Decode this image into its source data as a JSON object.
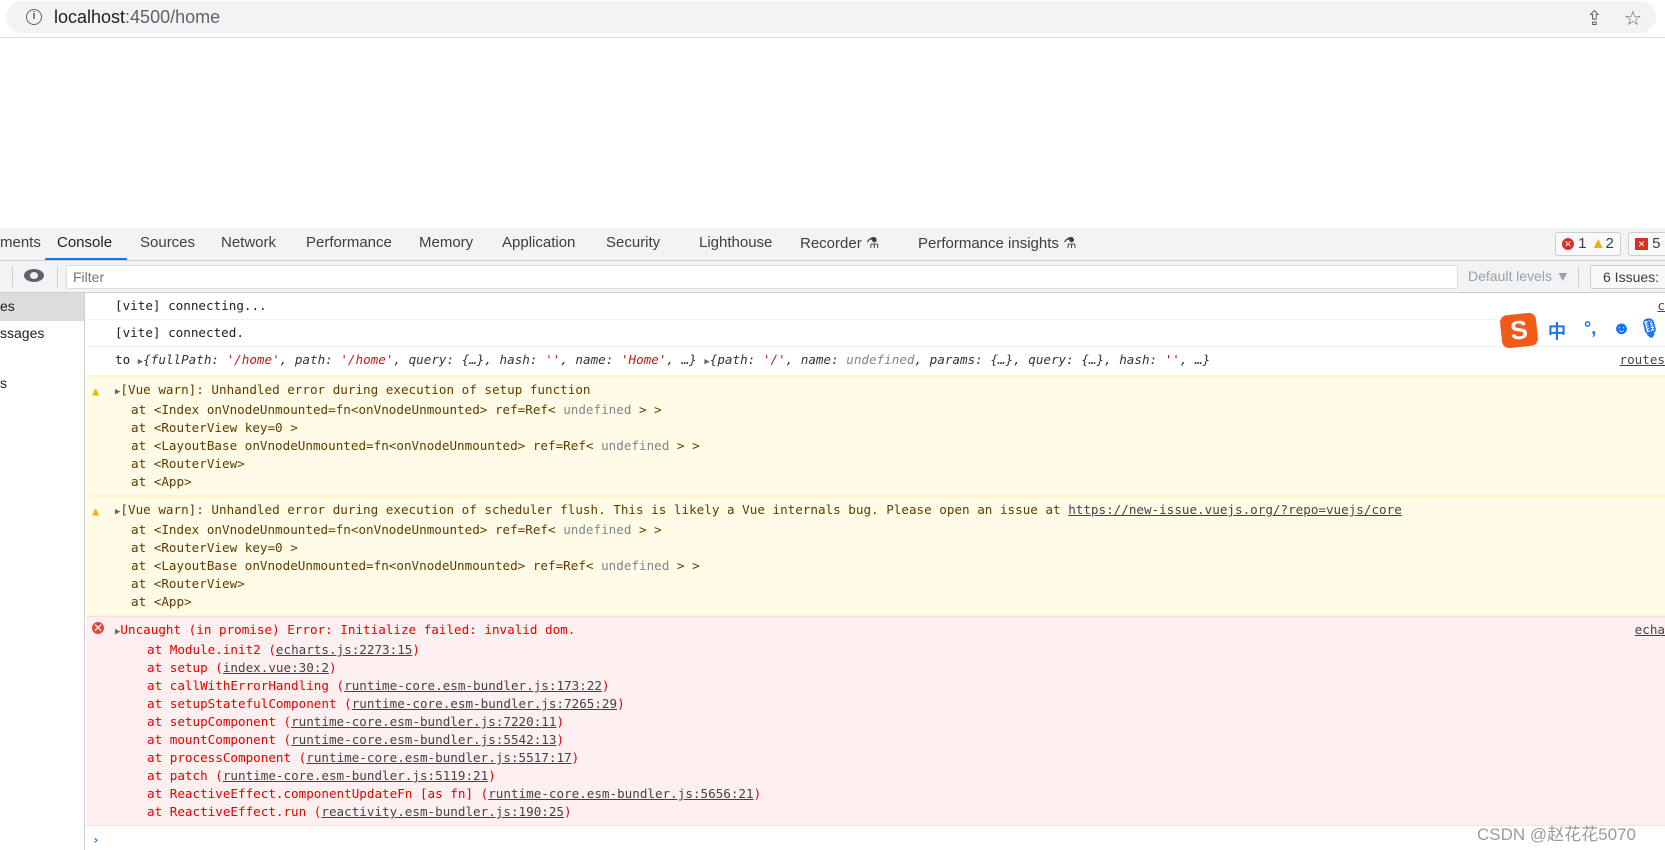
{
  "browser": {
    "url_host": "localhost",
    "url_rest": ":4500/home",
    "share_icon": "share-icon",
    "star_icon": "star-icon"
  },
  "devtools": {
    "tabs": [
      "ments",
      "Console",
      "Sources",
      "Network",
      "Performance",
      "Memory",
      "Application",
      "Security",
      "Lighthouse",
      "Recorder ⚗",
      "Performance insights ⚗"
    ],
    "active_tab": "Console",
    "counts": {
      "errors": "1",
      "warnings": "2",
      "issues": "5"
    },
    "toolbar": {
      "filter_placeholder": "Filter",
      "levels": "Default levels ▼",
      "issues": "6 Issues:"
    },
    "sidebar": [
      "es",
      "ssages",
      "",
      "s"
    ],
    "rows": [
      {
        "type": "log",
        "segs": [
          {
            "t": "[vite] connecting..."
          }
        ],
        "src": "c"
      },
      {
        "type": "log",
        "segs": [
          {
            "t": "[vite] connected."
          }
        ],
        "src": ""
      },
      {
        "type": "log",
        "segs": [
          {
            "t": "to "
          },
          {
            "t": "▶",
            "c": "exp"
          },
          {
            "t": "{fullPath: ",
            "c": "it"
          },
          {
            "t": "'/home'",
            "c": "str it"
          },
          {
            "t": ", path: ",
            "c": "it"
          },
          {
            "t": "'/home'",
            "c": "str it"
          },
          {
            "t": ", query: {…}, hash: ",
            "c": "it"
          },
          {
            "t": "''",
            "c": "str it"
          },
          {
            "t": ", name: ",
            "c": "it"
          },
          {
            "t": "'Home'",
            "c": "str it"
          },
          {
            "t": ", …} ",
            "c": "it"
          },
          {
            "t": "▶",
            "c": "exp"
          },
          {
            "t": "{path: ",
            "c": "it"
          },
          {
            "t": "'/'",
            "c": "str it"
          },
          {
            "t": ", name: ",
            "c": "it"
          },
          {
            "t": "undefined",
            "c": "gray it"
          },
          {
            "t": ", params: {…}, query: {…}, hash: ",
            "c": "it"
          },
          {
            "t": "''",
            "c": "str it"
          },
          {
            "t": ", …}",
            "c": "it"
          }
        ],
        "src": "routes"
      },
      {
        "type": "warn",
        "head": "[Vue warn]: Unhandled error during execution of setup function",
        "link": "",
        "sub": [
          [
            {
              "t": "at <Index onVnodeUnmounted=fn<onVnodeUnmounted> ref=Ref< "
            },
            {
              "t": "undefined",
              "c": "gray"
            },
            {
              "t": " > >"
            }
          ],
          [
            {
              "t": "at <RouterView key=0 >"
            }
          ],
          [
            {
              "t": "at <LayoutBase onVnodeUnmounted=fn<onVnodeUnmounted> ref=Ref< "
            },
            {
              "t": "undefined",
              "c": "gray"
            },
            {
              "t": " > >"
            }
          ],
          [
            {
              "t": "at <RouterView>"
            }
          ],
          [
            {
              "t": "at <App>"
            }
          ]
        ]
      },
      {
        "type": "warn",
        "head": "[Vue warn]: Unhandled error during execution of scheduler flush. This is likely a Vue internals bug. Please open an issue at ",
        "link": "https://new-issue.vuejs.org/?repo=vuejs/core",
        "sub": [
          [
            {
              "t": "at <Index onVnodeUnmounted=fn<onVnodeUnmounted> ref=Ref< "
            },
            {
              "t": "undefined",
              "c": "gray"
            },
            {
              "t": " > >"
            }
          ],
          [
            {
              "t": "at <RouterView key=0 >"
            }
          ],
          [
            {
              "t": "at <LayoutBase onVnodeUnmounted=fn<onVnodeUnmounted> ref=Ref< "
            },
            {
              "t": "undefined",
              "c": "gray"
            },
            {
              "t": " > >"
            }
          ],
          [
            {
              "t": "at <RouterView>"
            }
          ],
          [
            {
              "t": "at <App>"
            }
          ]
        ]
      },
      {
        "type": "err",
        "head": "Uncaught (in promise) Error: Initialize failed: invalid dom.",
        "src": "echa",
        "stack": [
          {
            "fn": "at Module.init2 (",
            "file": "echarts.js:2273:15"
          },
          {
            "fn": "at setup (",
            "file": "index.vue:30:2"
          },
          {
            "fn": "at callWithErrorHandling (",
            "file": "runtime-core.esm-bundler.js:173:22"
          },
          {
            "fn": "at setupStatefulComponent (",
            "file": "runtime-core.esm-bundler.js:7265:29"
          },
          {
            "fn": "at setupComponent (",
            "file": "runtime-core.esm-bundler.js:7220:11"
          },
          {
            "fn": "at mountComponent (",
            "file": "runtime-core.esm-bundler.js:5542:13"
          },
          {
            "fn": "at processComponent (",
            "file": "runtime-core.esm-bundler.js:5517:17"
          },
          {
            "fn": "at patch (",
            "file": "runtime-core.esm-bundler.js:5119:21"
          },
          {
            "fn": "at ReactiveEffect.componentUpdateFn [as fn] (",
            "file": "runtime-core.esm-bundler.js:5656:21"
          },
          {
            "fn": "at ReactiveEffect.run (",
            "file": "reactivity.esm-bundler.js:190:25"
          }
        ]
      }
    ],
    "prompt": "›"
  },
  "ime": {
    "logo": "S",
    "lang": "中",
    "punct": "°,",
    "emoji_icon": "emoji-icon",
    "mic_icon": "mic-icon"
  },
  "watermark": "CSDN @赵花花5070",
  "colors": {
    "accent": "#1a73e8",
    "error": "#e50000",
    "warn_bg": "#fffbe6",
    "err_bg": "#fef0f0"
  }
}
